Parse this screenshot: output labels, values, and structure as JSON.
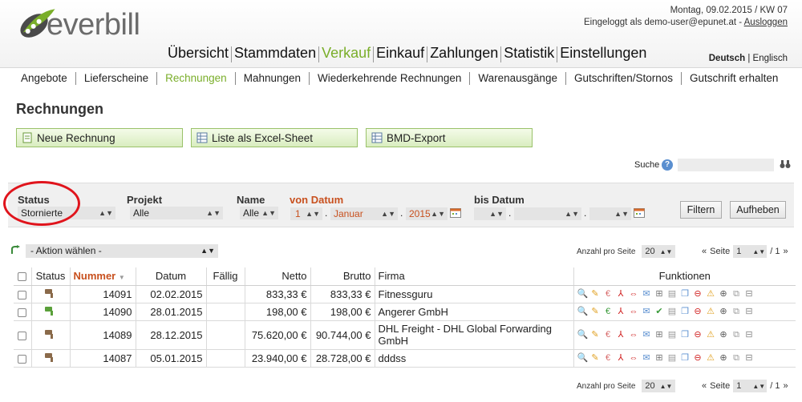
{
  "header": {
    "logo_text": "everbill",
    "date_line": "Montag, 09.02.2015 / KW 07",
    "login_prefix": "Eingeloggt als demo-user@epunet.at -",
    "logout_label": "Ausloggen",
    "lang_active": "Deutsch",
    "lang_sep": "|",
    "lang_other": "Englisch"
  },
  "mainnav": [
    {
      "label": "Übersicht",
      "active": false
    },
    {
      "label": "Stammdaten",
      "active": false
    },
    {
      "label": "Verkauf",
      "active": true
    },
    {
      "label": "Einkauf",
      "active": false
    },
    {
      "label": "Zahlungen",
      "active": false
    },
    {
      "label": "Statistik",
      "active": false
    },
    {
      "label": "Einstellungen",
      "active": false
    }
  ],
  "subnav": [
    {
      "label": "Angebote",
      "active": false
    },
    {
      "label": "Lieferscheine",
      "active": false
    },
    {
      "label": "Rechnungen",
      "active": true
    },
    {
      "label": "Mahnungen",
      "active": false
    },
    {
      "label": "Wiederkehrende Rechnungen",
      "active": false
    },
    {
      "label": "Warenausgänge",
      "active": false
    },
    {
      "label": "Gutschriften/Stornos",
      "active": false
    },
    {
      "label": "Gutschrift erhalten",
      "active": false
    }
  ],
  "page": {
    "title": "Rechnungen",
    "buttons": {
      "new_invoice": "Neue Rechnung",
      "excel": "Liste als Excel-Sheet",
      "bmd": "BMD-Export"
    },
    "search_label": "Suche"
  },
  "filter": {
    "status_label": "Status",
    "status_value": "Stornierte",
    "project_label": "Projekt",
    "project_value": "Alle",
    "name_label": "Name",
    "name_value": "Alle",
    "from_label": "von Datum",
    "from_day": "1",
    "from_month": "Januar",
    "from_year": "2015",
    "to_label": "bis Datum",
    "to_day": "",
    "to_month": "",
    "to_year": "",
    "date_sep": ".",
    "filter_button": "Filtern",
    "reset_button": "Aufheben"
  },
  "actions": {
    "select_placeholder": "- Aktion wählen -"
  },
  "pager": {
    "per_page_label": "Anzahl pro Seite",
    "per_page_value": "20",
    "prev": "«",
    "page_label": "Seite",
    "page_value": "1",
    "of_label": "/ 1",
    "next": "»"
  },
  "table": {
    "headers": {
      "status": "Status",
      "number": "Nummer",
      "date": "Datum",
      "due": "Fällig",
      "net": "Netto",
      "gross": "Brutto",
      "company": "Firma",
      "functions": "Funktionen"
    },
    "rows": [
      {
        "number": "14091",
        "date": "02.02.2015",
        "due": "",
        "net": "833,33 €",
        "gross": "833,33 €",
        "company": "Fitnessguru",
        "status_color": "#8a6a4a"
      },
      {
        "number": "14090",
        "date": "28.01.2015",
        "due": "",
        "net": "198,00 €",
        "gross": "198,00 €",
        "company": "Angerer GmbH",
        "status_color": "#5aa03a"
      },
      {
        "number": "14089",
        "date": "28.12.2015",
        "due": "",
        "net": "75.620,00 €",
        "gross": "90.744,00 €",
        "company": "DHL Freight - DHL Global Forwarding GmbH",
        "status_color": "#8a6a4a"
      },
      {
        "number": "14087",
        "date": "05.01.2015",
        "due": "",
        "net": "23.940,00 €",
        "gross": "28.728,00 €",
        "company": "dddss",
        "status_color": "#8a6a4a"
      }
    ]
  },
  "colors": {
    "accent": "#7aae2a",
    "orange": "#c8501e",
    "circle": "#e0141c"
  }
}
